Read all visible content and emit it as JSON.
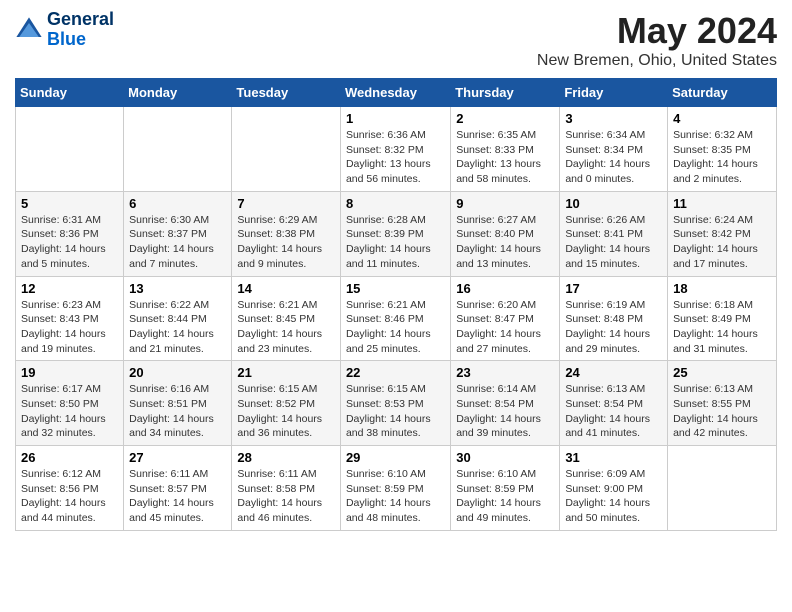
{
  "logo": {
    "line1": "General",
    "line2": "Blue"
  },
  "calendar": {
    "title": "May 2024",
    "subtitle": "New Bremen, Ohio, United States"
  },
  "headers": [
    "Sunday",
    "Monday",
    "Tuesday",
    "Wednesday",
    "Thursday",
    "Friday",
    "Saturday"
  ],
  "weeks": [
    [
      {
        "day": "",
        "info": ""
      },
      {
        "day": "",
        "info": ""
      },
      {
        "day": "",
        "info": ""
      },
      {
        "day": "1",
        "info": "Sunrise: 6:36 AM\nSunset: 8:32 PM\nDaylight: 13 hours\nand 56 minutes."
      },
      {
        "day": "2",
        "info": "Sunrise: 6:35 AM\nSunset: 8:33 PM\nDaylight: 13 hours\nand 58 minutes."
      },
      {
        "day": "3",
        "info": "Sunrise: 6:34 AM\nSunset: 8:34 PM\nDaylight: 14 hours\nand 0 minutes."
      },
      {
        "day": "4",
        "info": "Sunrise: 6:32 AM\nSunset: 8:35 PM\nDaylight: 14 hours\nand 2 minutes."
      }
    ],
    [
      {
        "day": "5",
        "info": "Sunrise: 6:31 AM\nSunset: 8:36 PM\nDaylight: 14 hours\nand 5 minutes."
      },
      {
        "day": "6",
        "info": "Sunrise: 6:30 AM\nSunset: 8:37 PM\nDaylight: 14 hours\nand 7 minutes."
      },
      {
        "day": "7",
        "info": "Sunrise: 6:29 AM\nSunset: 8:38 PM\nDaylight: 14 hours\nand 9 minutes."
      },
      {
        "day": "8",
        "info": "Sunrise: 6:28 AM\nSunset: 8:39 PM\nDaylight: 14 hours\nand 11 minutes."
      },
      {
        "day": "9",
        "info": "Sunrise: 6:27 AM\nSunset: 8:40 PM\nDaylight: 14 hours\nand 13 minutes."
      },
      {
        "day": "10",
        "info": "Sunrise: 6:26 AM\nSunset: 8:41 PM\nDaylight: 14 hours\nand 15 minutes."
      },
      {
        "day": "11",
        "info": "Sunrise: 6:24 AM\nSunset: 8:42 PM\nDaylight: 14 hours\nand 17 minutes."
      }
    ],
    [
      {
        "day": "12",
        "info": "Sunrise: 6:23 AM\nSunset: 8:43 PM\nDaylight: 14 hours\nand 19 minutes."
      },
      {
        "day": "13",
        "info": "Sunrise: 6:22 AM\nSunset: 8:44 PM\nDaylight: 14 hours\nand 21 minutes."
      },
      {
        "day": "14",
        "info": "Sunrise: 6:21 AM\nSunset: 8:45 PM\nDaylight: 14 hours\nand 23 minutes."
      },
      {
        "day": "15",
        "info": "Sunrise: 6:21 AM\nSunset: 8:46 PM\nDaylight: 14 hours\nand 25 minutes."
      },
      {
        "day": "16",
        "info": "Sunrise: 6:20 AM\nSunset: 8:47 PM\nDaylight: 14 hours\nand 27 minutes."
      },
      {
        "day": "17",
        "info": "Sunrise: 6:19 AM\nSunset: 8:48 PM\nDaylight: 14 hours\nand 29 minutes."
      },
      {
        "day": "18",
        "info": "Sunrise: 6:18 AM\nSunset: 8:49 PM\nDaylight: 14 hours\nand 31 minutes."
      }
    ],
    [
      {
        "day": "19",
        "info": "Sunrise: 6:17 AM\nSunset: 8:50 PM\nDaylight: 14 hours\nand 32 minutes."
      },
      {
        "day": "20",
        "info": "Sunrise: 6:16 AM\nSunset: 8:51 PM\nDaylight: 14 hours\nand 34 minutes."
      },
      {
        "day": "21",
        "info": "Sunrise: 6:15 AM\nSunset: 8:52 PM\nDaylight: 14 hours\nand 36 minutes."
      },
      {
        "day": "22",
        "info": "Sunrise: 6:15 AM\nSunset: 8:53 PM\nDaylight: 14 hours\nand 38 minutes."
      },
      {
        "day": "23",
        "info": "Sunrise: 6:14 AM\nSunset: 8:54 PM\nDaylight: 14 hours\nand 39 minutes."
      },
      {
        "day": "24",
        "info": "Sunrise: 6:13 AM\nSunset: 8:54 PM\nDaylight: 14 hours\nand 41 minutes."
      },
      {
        "day": "25",
        "info": "Sunrise: 6:13 AM\nSunset: 8:55 PM\nDaylight: 14 hours\nand 42 minutes."
      }
    ],
    [
      {
        "day": "26",
        "info": "Sunrise: 6:12 AM\nSunset: 8:56 PM\nDaylight: 14 hours\nand 44 minutes."
      },
      {
        "day": "27",
        "info": "Sunrise: 6:11 AM\nSunset: 8:57 PM\nDaylight: 14 hours\nand 45 minutes."
      },
      {
        "day": "28",
        "info": "Sunrise: 6:11 AM\nSunset: 8:58 PM\nDaylight: 14 hours\nand 46 minutes."
      },
      {
        "day": "29",
        "info": "Sunrise: 6:10 AM\nSunset: 8:59 PM\nDaylight: 14 hours\nand 48 minutes."
      },
      {
        "day": "30",
        "info": "Sunrise: 6:10 AM\nSunset: 8:59 PM\nDaylight: 14 hours\nand 49 minutes."
      },
      {
        "day": "31",
        "info": "Sunrise: 6:09 AM\nSunset: 9:00 PM\nDaylight: 14 hours\nand 50 minutes."
      },
      {
        "day": "",
        "info": ""
      }
    ]
  ]
}
